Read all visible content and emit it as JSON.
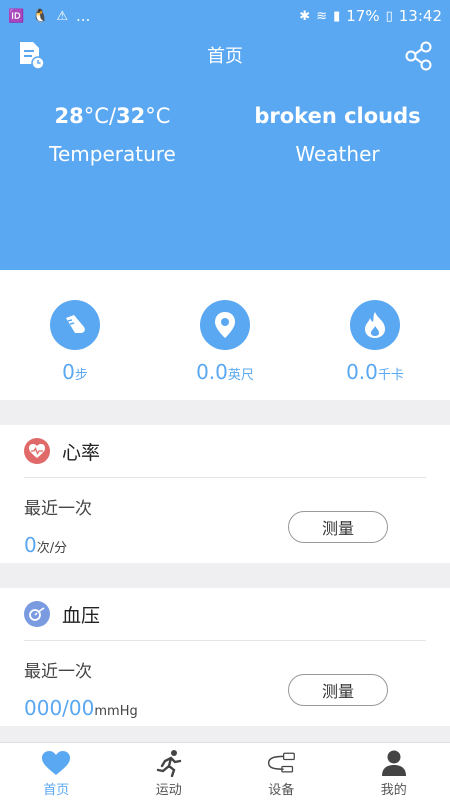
{
  "status_bar": {
    "left_items": [
      "🆔",
      "🐧",
      "⚠",
      "..."
    ],
    "battery": "17%",
    "time": "13:42"
  },
  "header": {
    "title": "首页"
  },
  "weather": {
    "temp_low": "28",
    "temp_high": "32",
    "temp_unit": "°C",
    "temp_sep": "/",
    "temp_label": "Temperature",
    "condition": "broken clouds",
    "condition_label": "Weather"
  },
  "stats": [
    {
      "value": "0",
      "unit": "步",
      "icon": "shoe-icon"
    },
    {
      "value": "0.0",
      "unit": "英尺",
      "icon": "location-pin-icon"
    },
    {
      "value": "0.0",
      "unit": "千卡",
      "icon": "flame-icon"
    }
  ],
  "heart_rate": {
    "title": "心率",
    "recent_label": "最近一次",
    "value": "0",
    "unit": "次/分",
    "button": "测量"
  },
  "blood_pressure": {
    "title": "血压",
    "recent_label": "最近一次",
    "value": "000/00",
    "unit": "mmHg",
    "button": "测量"
  },
  "tabs": [
    {
      "label": "首页",
      "icon": "heart-icon",
      "active": true
    },
    {
      "label": "运动",
      "icon": "running-icon",
      "active": false
    },
    {
      "label": "设备",
      "icon": "device-icon",
      "active": false
    },
    {
      "label": "我的",
      "icon": "person-icon",
      "active": false
    }
  ],
  "colors": {
    "accent": "#5ba8f2",
    "heart_icon_bg": "#e06a6a",
    "bp_icon_bg": "#7b9be0"
  }
}
